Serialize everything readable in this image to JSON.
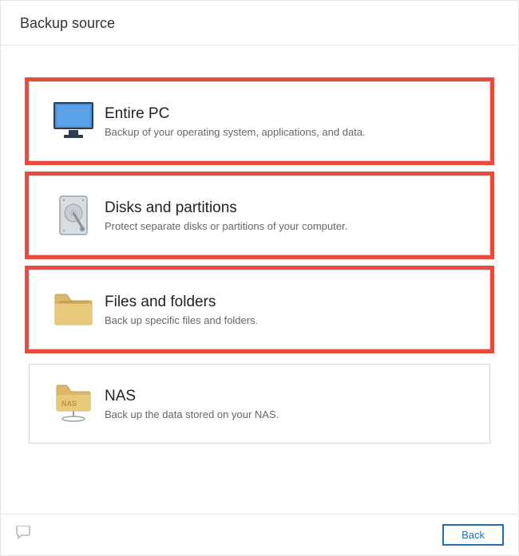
{
  "header": {
    "title": "Backup source"
  },
  "options": {
    "entire_pc": {
      "title": "Entire PC",
      "desc": "Backup of your operating system, applications, and data."
    },
    "disks": {
      "title": "Disks and partitions",
      "desc": "Protect separate disks or partitions of your computer."
    },
    "files": {
      "title": "Files and folders",
      "desc": "Back up specific files and folders."
    },
    "nas": {
      "title": "NAS",
      "desc": "Back up the data stored on your NAS."
    }
  },
  "footer": {
    "back_label": "Back"
  }
}
